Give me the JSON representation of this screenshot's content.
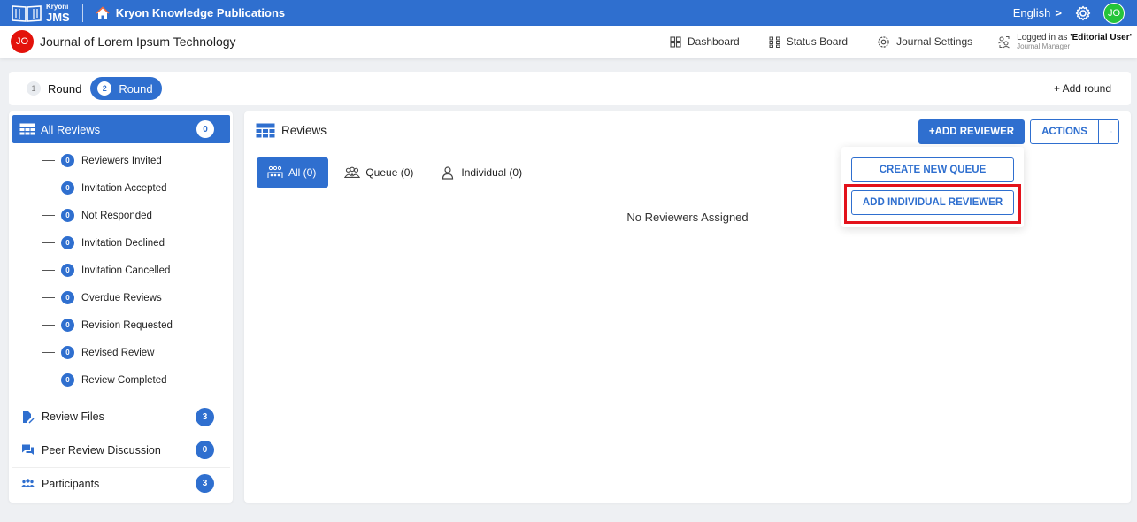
{
  "topbar": {
    "brand_small": "Kryoni",
    "brand_big": "JMS",
    "org_name": "Kryon Knowledge Publications",
    "language": "English",
    "language_chevron": ">",
    "user_initials": "JO",
    "icons": [
      "book-logo-icon",
      "home-icon",
      "gear-icon"
    ]
  },
  "journal": {
    "initials": "JO",
    "title": "Journal of Lorem Ipsum Technology",
    "nav": {
      "dashboard": "Dashboard",
      "status_board": "Status Board",
      "settings": "Journal Settings"
    },
    "logged_in_prefix": "Logged in as ",
    "logged_in_user": "'Editorial User'",
    "role": "Journal Manager"
  },
  "rounds": {
    "tabs": [
      {
        "num": "1",
        "label": "Round"
      },
      {
        "num": "2",
        "label": "Round"
      }
    ],
    "add_round": "+ Add round"
  },
  "sidebar": {
    "all_reviews": {
      "label": "All Reviews",
      "count": "0"
    },
    "items": [
      {
        "label": "Reviewers Invited",
        "count": "0"
      },
      {
        "label": "Invitation Accepted",
        "count": "0"
      },
      {
        "label": "Not Responded",
        "count": "0"
      },
      {
        "label": "Invitation Declined",
        "count": "0"
      },
      {
        "label": "Invitation Cancelled",
        "count": "0"
      },
      {
        "label": "Overdue Reviews",
        "count": "0"
      },
      {
        "label": "Revision Requested",
        "count": "0"
      },
      {
        "label": "Revised Review",
        "count": "0"
      },
      {
        "label": "Review Completed",
        "count": "0"
      }
    ],
    "sections": [
      {
        "label": "Review Files",
        "count": "3"
      },
      {
        "label": "Peer Review Discussion",
        "count": "0"
      },
      {
        "label": "Participants",
        "count": "3"
      }
    ]
  },
  "main": {
    "title": "Reviews",
    "add_reviewer": "+ADD REVIEWER",
    "actions": "ACTIONS",
    "filters": {
      "all": "All (0)",
      "queue": "Queue (0)",
      "individual": "Individual (0)"
    },
    "empty_message": "No Reviewers Assigned"
  },
  "dropdown": {
    "create_queue": "CREATE NEW QUEUE",
    "add_individual": "ADD INDIVIDUAL REVIEWER"
  },
  "colors": {
    "primary": "#2f6fcf",
    "highlight": "#e3121b",
    "avatar_user": "#25c43a",
    "avatar_journal": "#e3120b"
  }
}
